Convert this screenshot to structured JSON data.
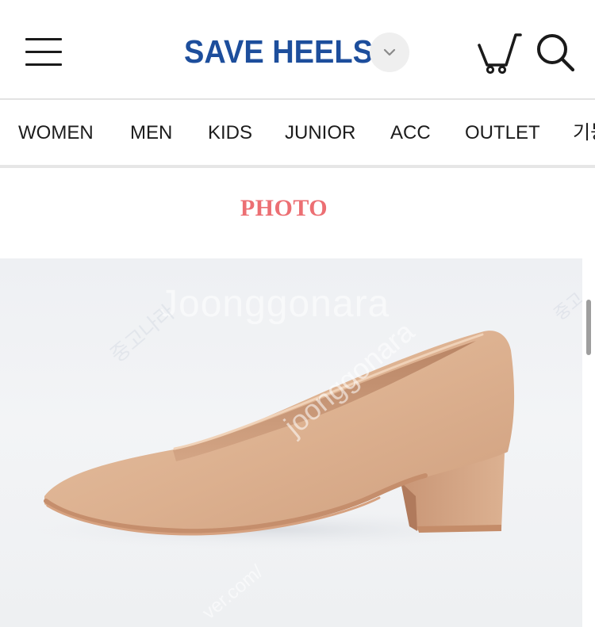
{
  "header": {
    "logo": "SAVE HEELS",
    "icons": {
      "menu": "hamburger-menu-icon",
      "brand_dropdown": "chevron-down-icon",
      "cart": "cart-icon",
      "search": "search-icon"
    }
  },
  "nav": {
    "items": [
      "WOMEN",
      "MEN",
      "KIDS",
      "JUNIOR",
      "ACC",
      "OUTLET",
      "기능"
    ]
  },
  "section": {
    "title": "PHOTO"
  },
  "watermark": {
    "main": "Joonggonara",
    "diagonal": "joonggonara",
    "corner_left": "중고나라",
    "corner_right": "중고",
    "url_fragment": "ver.com/"
  },
  "colors": {
    "brand": "#1d4e9c",
    "section_title": "#ec6f73"
  }
}
